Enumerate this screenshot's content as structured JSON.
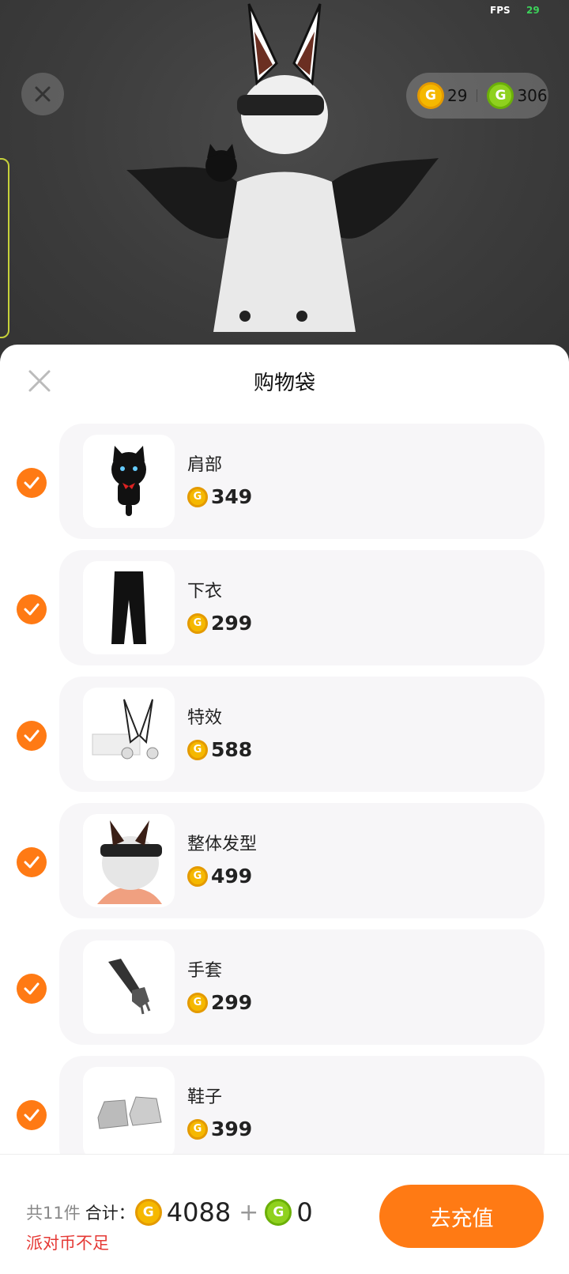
{
  "hud": {
    "fps_label": "FPS",
    "fps_value": "29"
  },
  "wallet": {
    "gold_amount": "29",
    "green_amount": "306"
  },
  "sheet": {
    "title": "购物袋"
  },
  "items": [
    {
      "name": "肩部",
      "price": "349",
      "thumb": "black-cat-shoulder-icon"
    },
    {
      "name": "下衣",
      "price": "299",
      "thumb": "black-pants-icon"
    },
    {
      "name": "特效",
      "price": "588",
      "thumb": "bunny-ears-effect-icon"
    },
    {
      "name": "整体发型",
      "price": "499",
      "thumb": "hairstyle-icon"
    },
    {
      "name": "手套",
      "price": "299",
      "thumb": "glove-icon"
    },
    {
      "name": "鞋子",
      "price": "399",
      "thumb": "shoes-icon"
    }
  ],
  "footer": {
    "count_label": "共11件",
    "total_label": "合计：",
    "gold_total": "4088",
    "plus": "+",
    "green_total": "0",
    "warning": "派对币不足",
    "recharge_label": "去充值"
  },
  "colors": {
    "accent": "#ff7a14",
    "gold_coin": "#f5b800",
    "green_coin": "#8fd11e",
    "warning": "#e53935"
  }
}
